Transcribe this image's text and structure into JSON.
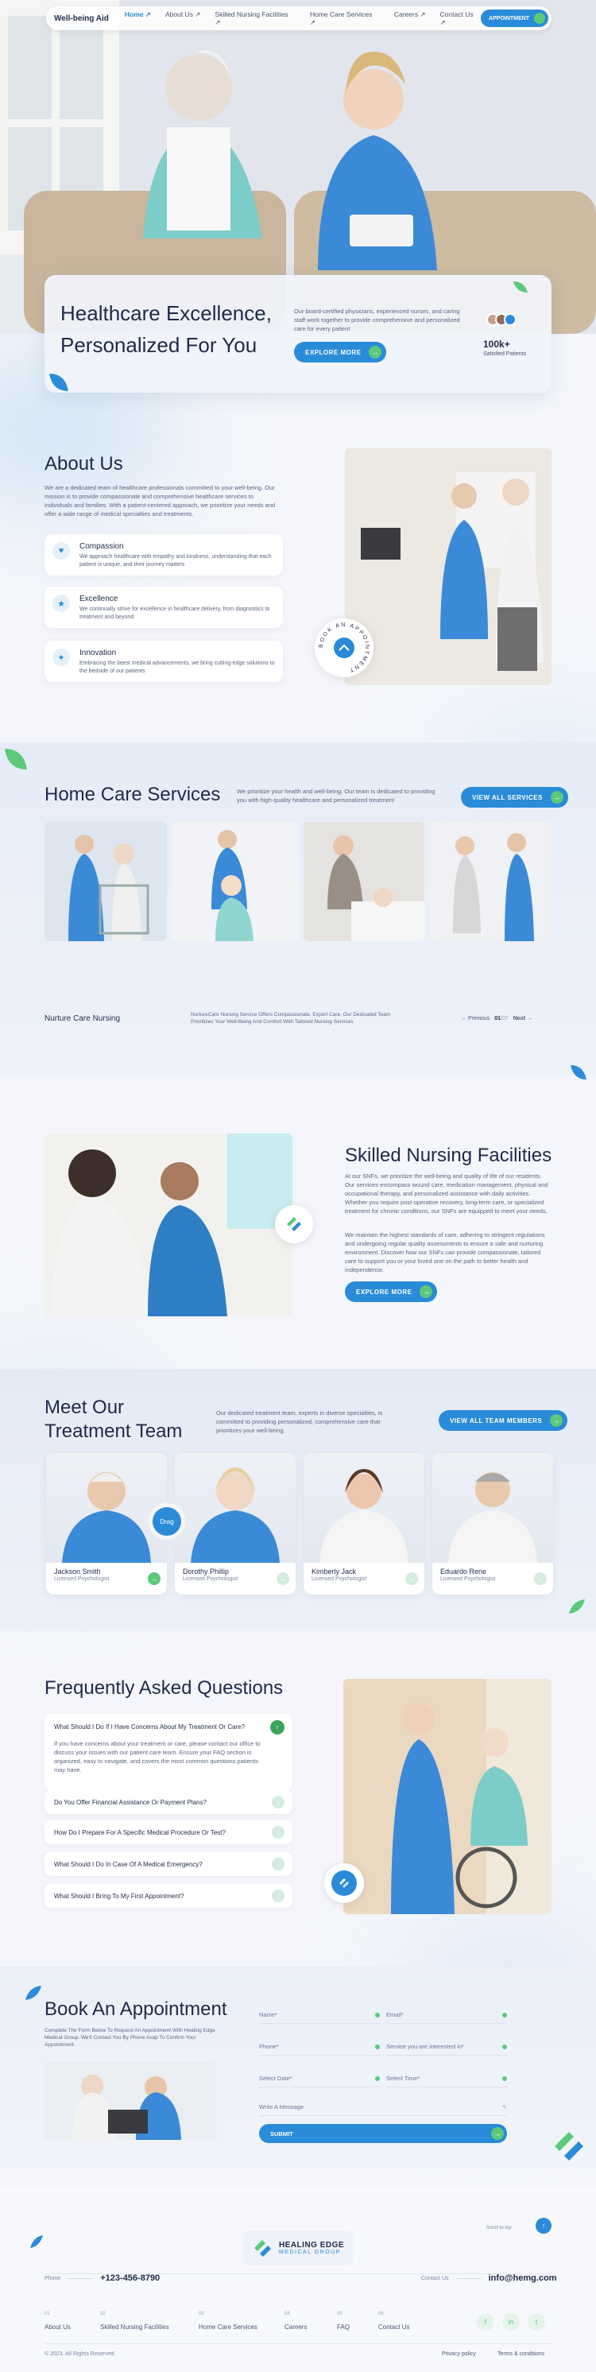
{
  "nav": {
    "logo": "Well-being Aid",
    "links": [
      "Home ↗",
      "About Us ↗",
      "Skilled Nursing Facilities ↗",
      "Home Care Services ↗",
      "Careers ↗",
      "Contact Us ↗"
    ],
    "appointment": "APPOINTMENT"
  },
  "hero": {
    "title_line1": "Healthcare Excellence,",
    "title_line2": "Personalized For You",
    "text": "Our board-certified physicians, experienced nurses, and caring staff work together to provide comprehensive and personalized care for every patient",
    "button": "EXPLORE MORE",
    "stat_value": "100k+",
    "stat_label": "Satisfied Patients"
  },
  "about": {
    "title": "About Us",
    "text": "We are a dedicated team of healthcare professionals committed to your well-being. Our mission is to provide compassionate and comprehensive healthcare services to individuals and families. With a patient-centered approach, we prioritize your needs and offer a wide range of medical specialties and treatments.",
    "features": [
      {
        "title": "Compassion",
        "text": "We approach healthcare with empathy and kindness, understanding that each patient is unique, and their journey matters"
      },
      {
        "title": "Excellence",
        "text": "We continually strive for excellence in healthcare delivery, from diagnostics to treatment and beyond"
      },
      {
        "title": "Innovation",
        "text": "Embracing the latest medical advancements, we bring cutting-edge solutions to the bedside of our patients"
      }
    ],
    "badge_text": "BOOK AN APPOINTMENT"
  },
  "homecare": {
    "title": "Home Care Services",
    "text": "We prioritize your health and well-being. Our team is dedicated to providing you with high-quality healthcare and personalized treatment",
    "button": "VIEW ALL SERVICES",
    "caption_title": "Nurture Care Nursing",
    "caption_text": "NurtureCare Nursing Service Offers Compassionate, Expert Care. Our Dedicated Team Prioritizes Your Well-Being And Comfort With Tailored Nursing Services",
    "prev": "Previous",
    "pager_current": "01",
    "pager_total": "07",
    "next": "Next"
  },
  "snf": {
    "title": "Skilled Nursing Facilities",
    "text1": "At our SNFs, we prioritize the well-being and quality of life of our residents. Our services encompass wound care, medication management, physical and occupational therapy, and personalized assistance with daily activities. Whether you require post-operative recovery, long-term care, or specialized treatment for chronic conditions, our SNFs are equipped to meet your needs.",
    "text2": "We maintain the highest standards of care, adhering to stringent regulations and undergoing regular quality assessments to ensure a safe and nurturing environment. Discover how our SNFs can provide compassionate, tailored care to support you or your loved one on the path to better health and independence.",
    "button": "EXPLORE MORE"
  },
  "team": {
    "title_line1": "Meet Our",
    "title_line2": "Treatment Team",
    "text": "Our dedicated treatment team, experts in diverse specialties, is committed to providing personalized, comprehensive care that prioritizes your well-being",
    "button": "VIEW ALL TEAM MEMBERS",
    "drag": "Drag",
    "members": [
      {
        "name": "Jackson Smith",
        "role": "Licensed Psychologist"
      },
      {
        "name": "Dorothy Phillip",
        "role": "Licensed Psychologist"
      },
      {
        "name": "Kimberly Jack",
        "role": "Licensed Psychologist"
      },
      {
        "name": "Eduardo Rene",
        "role": "Licensed Psychologist"
      }
    ]
  },
  "faq": {
    "title": "Frequently Asked Questions",
    "open_question": "What Should I Do If I Have Concerns About My Treatment Or Care?",
    "open_answer": "If you have concerns about your treatment or care, please contact our office to discuss your issues with our patient care team. Ensure your FAQ section is organized, easy to navigate, and covers the most common questions patients may have.",
    "questions": [
      "Do You Offer Financial Assistance Or Payment Plans?",
      "How Do I Prepare For A Specific Medical Procedure Or Test?",
      "What Should I Do In Case Of A Medical Emergency?",
      "What Should I Bring To My First Appointment?"
    ]
  },
  "booking": {
    "title": "Book An Appointment",
    "text": "Complete The Form Below To Request An Appointment With Healing Edge Medical Group. We'll Contact You By Phone Asap To Confirm Your Appointment.",
    "fields": {
      "name": "Name*",
      "email": "Email*",
      "phone": "Phone*",
      "service": "Service you are interested in*",
      "date": "Select Date*",
      "time": "Select Time*",
      "message": "Write A Message"
    },
    "submit": "SUBMIT"
  },
  "footer": {
    "logo_line1": "HEALING EDGE",
    "logo_line2": "MEDICAL GROUP",
    "scroll": "Scroll to top",
    "phone_label": "Phone",
    "phone": "+123-456-8790",
    "contact_label": "Contact Us",
    "email": "info@hemg.com",
    "links": [
      {
        "num": "01",
        "label": "About Us"
      },
      {
        "num": "02",
        "label": "Skilled Nursing Facilities"
      },
      {
        "num": "03",
        "label": "Home Care Services"
      },
      {
        "num": "04",
        "label": "Careers"
      },
      {
        "num": "05",
        "label": "FAQ"
      },
      {
        "num": "06",
        "label": "Contact Us"
      }
    ],
    "copyright": "© 2023. All Rights Reserved",
    "privacy": "Privacy policy",
    "terms": "Terms & conditions",
    "social": [
      "f",
      "in",
      "t"
    ]
  },
  "colors": {
    "primary": "#2a8bd8",
    "accent": "#5cc97a",
    "dark": "#1e2a4a"
  }
}
